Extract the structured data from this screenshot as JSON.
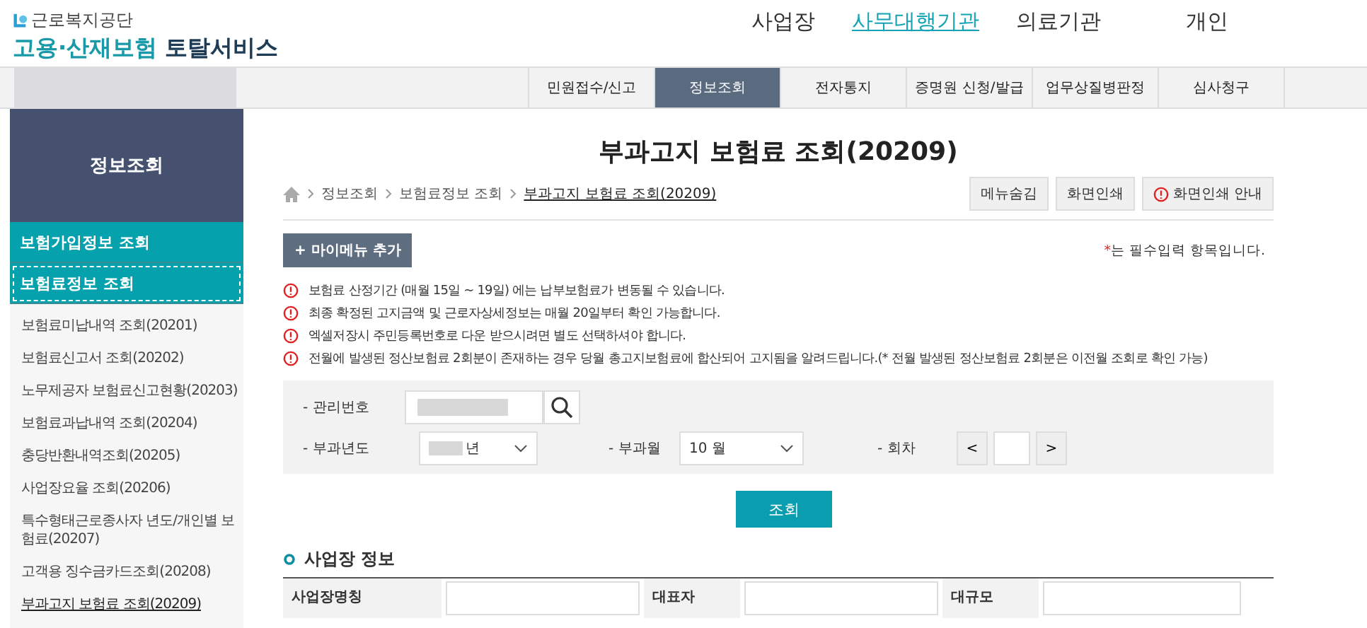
{
  "header": {
    "org_name": "근로복지공단",
    "service_name_accent": "고용·산재보험",
    "service_name_rest": "토탈서비스"
  },
  "user_types": [
    {
      "label": "사업장",
      "selected": false
    },
    {
      "label": "사무대행기관",
      "selected": true
    },
    {
      "label": "의료기관",
      "selected": false
    },
    {
      "label": "개인",
      "selected": false
    }
  ],
  "main_menu": [
    {
      "label": "민원접수/신고",
      "selected": false
    },
    {
      "label": "정보조회",
      "selected": true
    },
    {
      "label": "전자통지",
      "selected": false
    },
    {
      "label": "증명원 신청/발급",
      "selected": false
    },
    {
      "label": "업무상질병판정",
      "selected": false
    },
    {
      "label": "심사청구",
      "selected": false
    }
  ],
  "sidebar": {
    "title": "정보조회",
    "sections": [
      {
        "label": "보험가입정보 조회",
        "selected": false
      },
      {
        "label": "보험료정보 조회",
        "selected": true
      }
    ],
    "items": [
      {
        "label": "보험료미납내역 조회(20201)",
        "selected": false
      },
      {
        "label": "보험료신고서 조회(20202)",
        "selected": false
      },
      {
        "label": "노무제공자 보험료신고현황(20203)",
        "selected": false
      },
      {
        "label": "보험료과납내역 조회(20204)",
        "selected": false
      },
      {
        "label": "충당반환내역조회(20205)",
        "selected": false
      },
      {
        "label": "사업장요율 조회(20206)",
        "selected": false
      },
      {
        "label": "특수형태근로종사자 년도/개인별 보험료(20207)",
        "selected": false
      },
      {
        "label": "고객용 징수금카드조회(20208)",
        "selected": false
      },
      {
        "label": "부과고지 보험료 조회(20209)",
        "selected": true
      }
    ]
  },
  "page_title": "부과고지 보험료 조회(20209)",
  "breadcrumb": [
    "정보조회",
    "보험료정보 조회",
    "부과고지 보험료 조회(20209)"
  ],
  "tool_buttons": [
    {
      "label": "메뉴숨김",
      "kind": "plain"
    },
    {
      "label": "화면인쇄",
      "kind": "plain"
    },
    {
      "label": "화면인쇄 안내",
      "kind": "info"
    }
  ],
  "my_menu_button": "+ 마이메뉴 추가",
  "required_note": {
    "mark": "*",
    "text": "는 필수입력 항목입니다."
  },
  "notices": [
    "보험료 산정기간 (매월 15일 ~ 19일) 에는 납부보험료가 변동될 수 있습니다.",
    "최종 확정된 고지금액 및 근로자상세정보는 매월 20일부터 확인 가능합니다.",
    "엑셀저장시 주민등록번호로 다운 받으시려면 별도 선택하셔야 합니다.",
    "전월에 발생된 정산보험료 2회분이 존재하는 경우 당월 총고지보험료에 합산되어 고지됨을 알려드립니다.(* 전월 발생된 정산보험료 2회분은 이전월 조회로 확인 가능)"
  ],
  "search": {
    "mgmt_label": "- 관리번호",
    "year_label": "- 부과년도",
    "year_unit": "년",
    "month_label": "- 부과월",
    "month_value": "10 월",
    "round_label": "- 회차",
    "prev": "<",
    "next": ">",
    "submit": "조회"
  },
  "section_title": "사업장 정보",
  "info_labels": [
    "사업장명칭",
    "대표자",
    "대규모"
  ]
}
